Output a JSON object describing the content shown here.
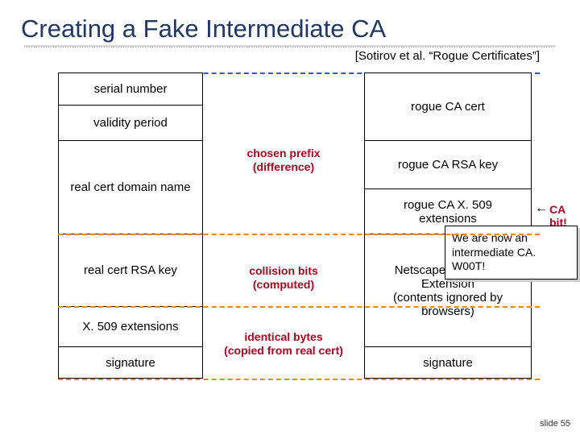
{
  "title": "Creating a Fake Intermediate CA",
  "citation": "[Sotirov et al. “Rogue Certificates”]",
  "left": {
    "serial": "serial number",
    "validity": "validity period",
    "domain": "real cert domain name",
    "rsa": "real cert RSA key",
    "ext": "X. 509 extensions",
    "sig": "signature"
  },
  "mid": {
    "prefix_l1": "chosen prefix",
    "prefix_l2": "(difference)",
    "collision_l1": "collision bits",
    "collision_l2": "(computed)",
    "ident_l1": "identical bytes",
    "ident_l2": "(copied from real cert)"
  },
  "right": {
    "rogue": "rogue CA cert",
    "rsa": "rogue CA RSA key",
    "ext_l1": "rogue CA X. 509",
    "ext_l2": "extensions",
    "netscape_l1": "Netscape Comment",
    "netscape_l2": "Extension",
    "netscape_l3": "(contents ignored by",
    "netscape_l4": "browsers)",
    "sig": "signature"
  },
  "callout": {
    "l1": "We are now an",
    "l2": "intermediate CA.",
    "l3": "W00T!"
  },
  "cabit_arrow": "←",
  "cabit": "CA bit!",
  "slidenum": "slide 55"
}
